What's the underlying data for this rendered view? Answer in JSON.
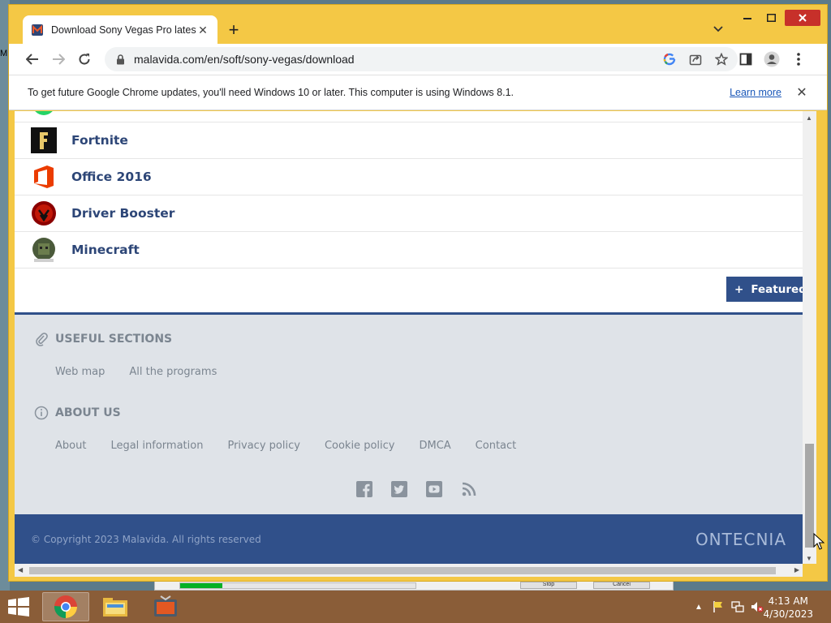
{
  "desktop": {
    "edge_letter": "M"
  },
  "behind_window": {
    "progress_fraction": 0.18,
    "buttons": [
      "Stop",
      "Cancel"
    ]
  },
  "browser": {
    "tab": {
      "title": "Download Sony Vegas Pro latest"
    },
    "address": {
      "url": "malavida.com/en/soft/sony-vegas/download"
    },
    "infobar": {
      "message": "To get future Google Chrome updates, you'll need Windows 10 or later. This computer is using Windows 8.1.",
      "learn_more": "Learn more"
    }
  },
  "page": {
    "apps": [
      {
        "name": "Fortnite",
        "icon": "fortnite-icon"
      },
      {
        "name": "Office 2016",
        "icon": "office-icon"
      },
      {
        "name": "Driver Booster",
        "icon": "driver-booster-icon"
      },
      {
        "name": "Minecraft",
        "icon": "minecraft-icon"
      }
    ],
    "featured_label": "Featured",
    "footer": {
      "useful_title": "USEFUL SECTIONS",
      "useful_links": [
        "Web map",
        "All the programs"
      ],
      "about_title": "ABOUT US",
      "about_links": [
        "About",
        "Legal information",
        "Privacy policy",
        "Cookie policy",
        "DMCA",
        "Contact"
      ],
      "socials": [
        "facebook-icon",
        "twitter-icon",
        "youtube-icon",
        "rss-icon"
      ],
      "copyright": "© Copyright 2023 Malavida. All rights reserved",
      "brand": "ONTECNIA"
    }
  },
  "taskbar": {
    "apps": [
      "Google Chrome",
      "File Explorer",
      "Media App"
    ],
    "clock_time": "4:13 AM",
    "clock_date": "4/30/2023"
  },
  "colors": {
    "chrome_frame": "#f4c845",
    "footer_band": "#30508a",
    "app_name": "#2d4677",
    "taskbar": "#8a5d38"
  }
}
